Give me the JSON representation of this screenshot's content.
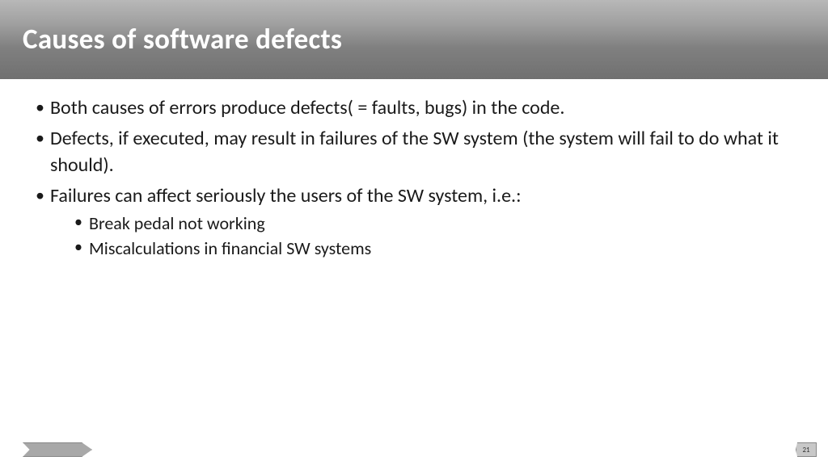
{
  "header": {
    "title": "Causes of software defects"
  },
  "content": {
    "bullets": [
      "Both causes of errors produce defects( = faults, bugs) in the code.",
      "Defects, if executed, may result in failures of the SW system (the system will fail to do what it should).",
      "Failures can affect seriously the users of the SW system, i.e.:"
    ],
    "subBullets": [
      "Break pedal not working",
      "Miscalculations in financial SW systems"
    ]
  },
  "footer": {
    "pageNumber": "21"
  }
}
